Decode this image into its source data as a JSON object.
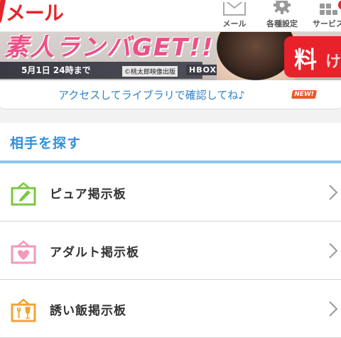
{
  "header": {
    "logo_j": "J",
    "logo_rest": "メール",
    "nav": [
      {
        "label": "メール",
        "icon": "envelope-icon"
      },
      {
        "label": "各種設定",
        "icon": "gear-icon"
      },
      {
        "label": "サービス",
        "icon": "grid-icon"
      }
    ]
  },
  "banner": {
    "headline": "素人ランバGET!!",
    "date": "5月1日 24時まで",
    "copyright": "©桃太郎映像出版",
    "brand": "HBOX.JP",
    "badge_text": "料",
    "badge_small": "け"
  },
  "access": {
    "text": "アクセスしてライブラリで確認してね♪",
    "new_label": "NEW!"
  },
  "section": {
    "title": "相手を探す",
    "items": [
      {
        "label": "ピュア掲示板",
        "icon": "pure-board-icon",
        "color": "#7bc83f"
      },
      {
        "label": "アダルト掲示板",
        "icon": "adult-board-icon",
        "color": "#f09ab8"
      },
      {
        "label": "誘い飯掲示板",
        "icon": "meal-board-icon",
        "color": "#f0a437"
      }
    ]
  },
  "colors": {
    "brand_red": "#e4242c",
    "accent_blue": "#2f91d8",
    "rule_blue": "#8cc4ec"
  }
}
